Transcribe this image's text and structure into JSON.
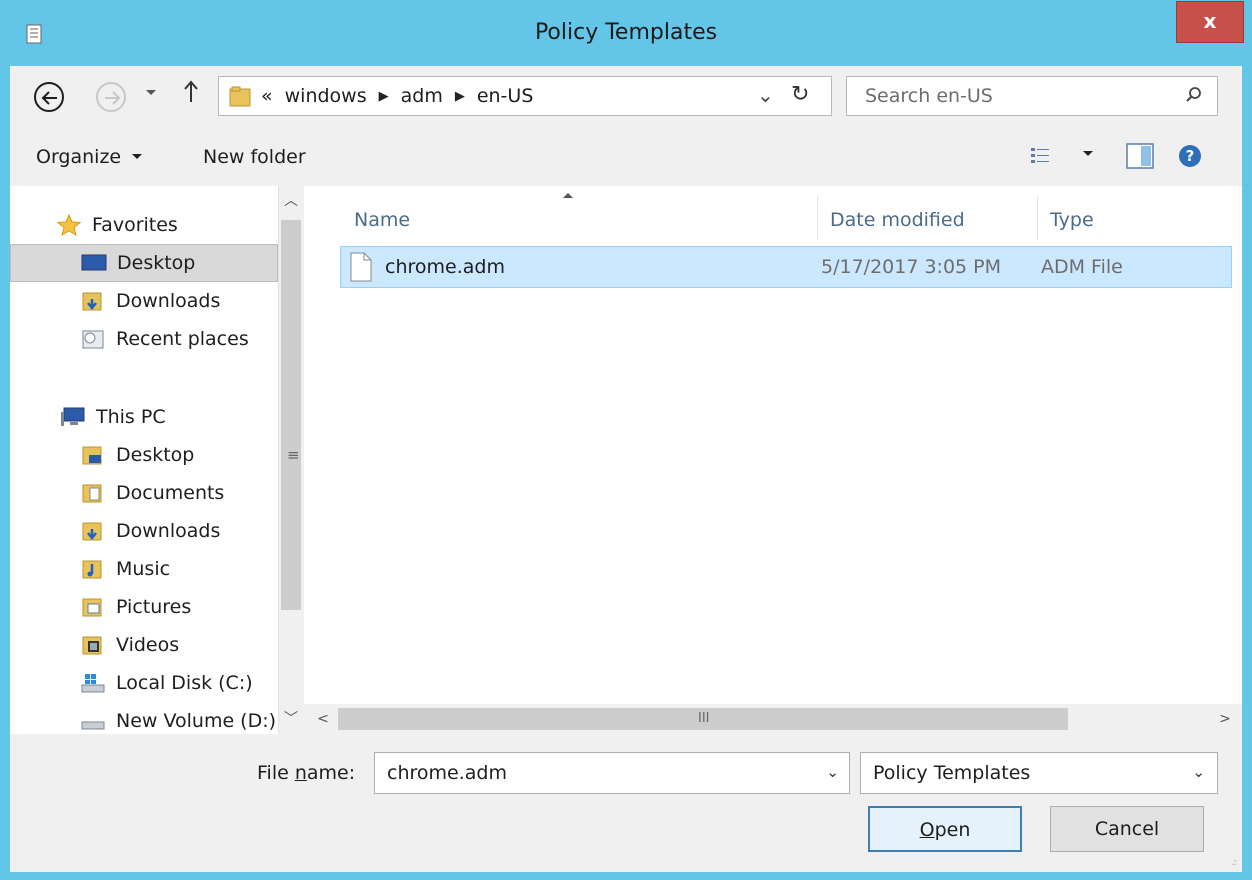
{
  "window": {
    "title": "Policy Templates",
    "close_label": "x"
  },
  "nav": {
    "breadcrumb": {
      "overflow": "«",
      "segments": [
        "windows",
        "adm",
        "en-US"
      ]
    },
    "search_placeholder": "Search en-US"
  },
  "commands": {
    "organize": "Organize",
    "new_folder": "New folder"
  },
  "sidebar": {
    "favorites_header": "Favorites",
    "favorites": [
      {
        "label": "Desktop",
        "icon": "desktop-icon",
        "selected": true
      },
      {
        "label": "Downloads",
        "icon": "downloads-icon"
      },
      {
        "label": "Recent places",
        "icon": "recent-places-icon"
      }
    ],
    "thispc_header": "This PC",
    "thispc": [
      {
        "label": "Desktop",
        "icon": "desktop-folder-icon"
      },
      {
        "label": "Documents",
        "icon": "documents-icon"
      },
      {
        "label": "Downloads",
        "icon": "downloads-icon"
      },
      {
        "label": "Music",
        "icon": "music-icon"
      },
      {
        "label": "Pictures",
        "icon": "pictures-icon"
      },
      {
        "label": "Videos",
        "icon": "videos-icon"
      },
      {
        "label": "Local Disk (C:)",
        "icon": "local-disk-icon"
      },
      {
        "label": "New Volume (D:)",
        "icon": "drive-icon"
      }
    ]
  },
  "files": {
    "columns": [
      "Name",
      "Date modified",
      "Type"
    ],
    "rows": [
      {
        "name": "chrome.adm",
        "modified": "5/17/2017 3:05 PM",
        "type": "ADM File",
        "selected": true
      }
    ]
  },
  "bottom": {
    "filename_label_prefix": "File ",
    "filename_label_accel": "n",
    "filename_label_suffix": "ame:",
    "filename_value": "chrome.adm",
    "filter_value": "Policy Templates",
    "open_accel": "O",
    "open_rest": "pen",
    "cancel_label": "Cancel"
  },
  "colors": {
    "frame": "#63c6e9",
    "close": "#c7504b",
    "selection": "#cce8ff"
  }
}
